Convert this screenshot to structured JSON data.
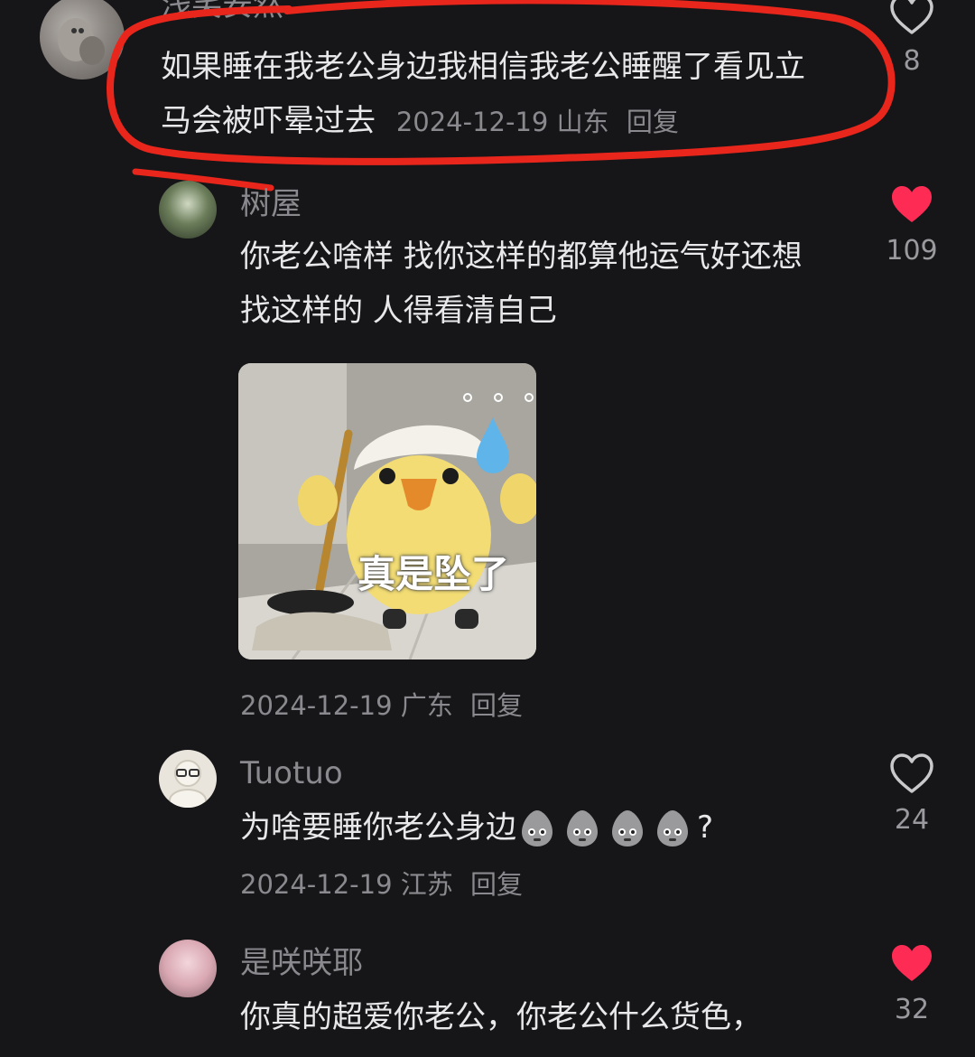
{
  "comments": [
    {
      "name": "浅笑安然",
      "text": "如果睡在我老公身边我相信我老公睡醒了看见立马会被吓晕过去",
      "date": "2024-12-19",
      "location": "山东",
      "reply": "回复",
      "likes": "8",
      "liked": false
    },
    {
      "name": "树屋",
      "text": "你老公啥样 找你这样的都算他运气好还想找这样的 人得看清自己",
      "sticker_caption": "真是坠了",
      "date": "2024-12-19",
      "location": "广东",
      "reply": "回复",
      "likes": "109",
      "liked": true
    },
    {
      "name": "Tuotuo",
      "text": "为啥要睡你老公身边",
      "text_tail": "?",
      "date": "2024-12-19",
      "location": "江苏",
      "reply": "回复",
      "likes": "24",
      "liked": false
    },
    {
      "name": "是咲咲耶",
      "text": "你真的超爱你老公，你老公什么货色，",
      "likes": "32",
      "liked": true
    }
  ],
  "colors": {
    "background": "#161619",
    "text": "#e8e8ea",
    "muted": "#8a8a8e",
    "like_red": "#fe2c55",
    "annotation": "#e8261c"
  },
  "icons": [
    "heart-outline-icon",
    "heart-filled-icon",
    "sweat-emoji-icon"
  ]
}
